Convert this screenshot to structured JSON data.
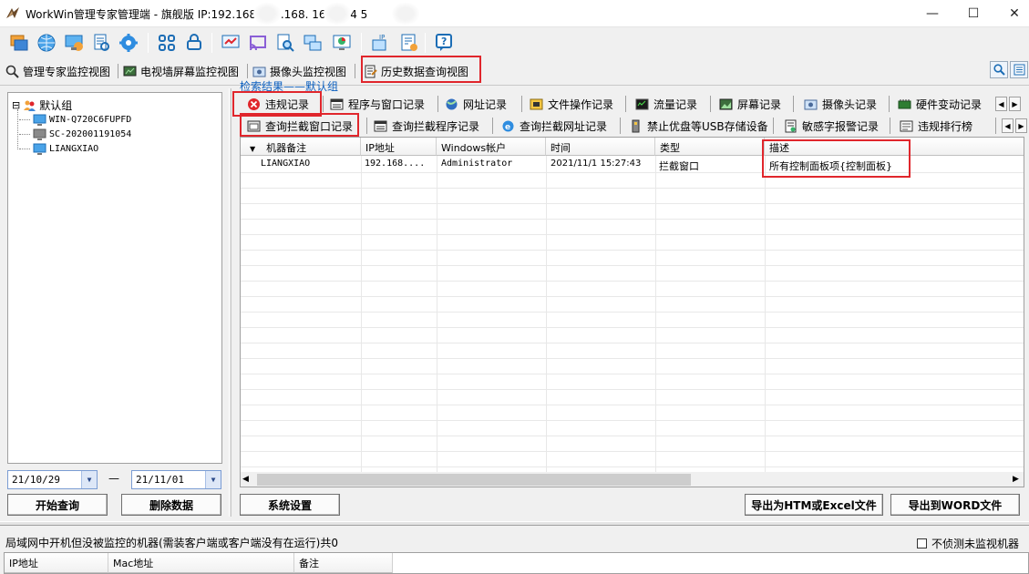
{
  "window": {
    "title": "WorkWin管理专家管理端 - 旗舰版 IP:192.168       192.168.       169.254       5",
    "minimize": "—",
    "maximize": "☐",
    "close": "✕"
  },
  "view_tabs": [
    {
      "label": "管理专家监控视图",
      "icon": "management-view-icon"
    },
    {
      "label": "电视墙屏幕监控视图",
      "icon": "tv-wall-icon"
    },
    {
      "label": "摄像头监控视图",
      "icon": "camera-view-icon"
    },
    {
      "label": "历史数据查询视图",
      "icon": "history-query-icon",
      "selected": true
    }
  ],
  "tree": {
    "root": "默认组",
    "expander": "⊟",
    "children": [
      "WIN-Q720C6FUPFD",
      "SC-202001191054",
      "LIANGXIAO"
    ]
  },
  "search_label": "检索结果——默认组",
  "date_range": {
    "from": "21/10/29",
    "separator": "—",
    "to": "21/11/01"
  },
  "buttons": {
    "start_query": "开始查询",
    "delete_data": "删除数据",
    "system_settings": "系统设置",
    "export_htm": "导出为HTM或Excel文件",
    "export_word": "导出到WORD文件"
  },
  "record_tabs_row1": [
    "违规记录",
    "程序与窗口记录",
    "网址记录",
    "文件操作记录",
    "流量记录",
    "屏幕记录",
    "摄像头记录",
    "硬件变动记录"
  ],
  "record_tabs_row2": [
    "查询拦截窗口记录",
    "查询拦截程序记录",
    "查询拦截网址记录",
    "禁止优盘等USB存储设备",
    "敏感字报警记录",
    "违规排行榜"
  ],
  "grid": {
    "columns": [
      "机器备注",
      "IP地址",
      "Windows帐户",
      "时间",
      "类型",
      "描述"
    ],
    "rows": [
      [
        "LIANGXIAO",
        "192.168....",
        "Administrator",
        "2021/11/1 15:27:43",
        "拦截窗口",
        "所有控制面板项{控制面板}"
      ]
    ]
  },
  "bottom": {
    "message": "局域网中开机但没被监控的机器(需装客户端或客户端没有在运行)共0",
    "checkbox_label": "不侦测未监视机器",
    "columns": [
      "IP地址",
      "Mac地址",
      "备注"
    ]
  },
  "colors": {
    "highlight_box": "#e0262c",
    "accent_blue": "#0b5fbf"
  }
}
